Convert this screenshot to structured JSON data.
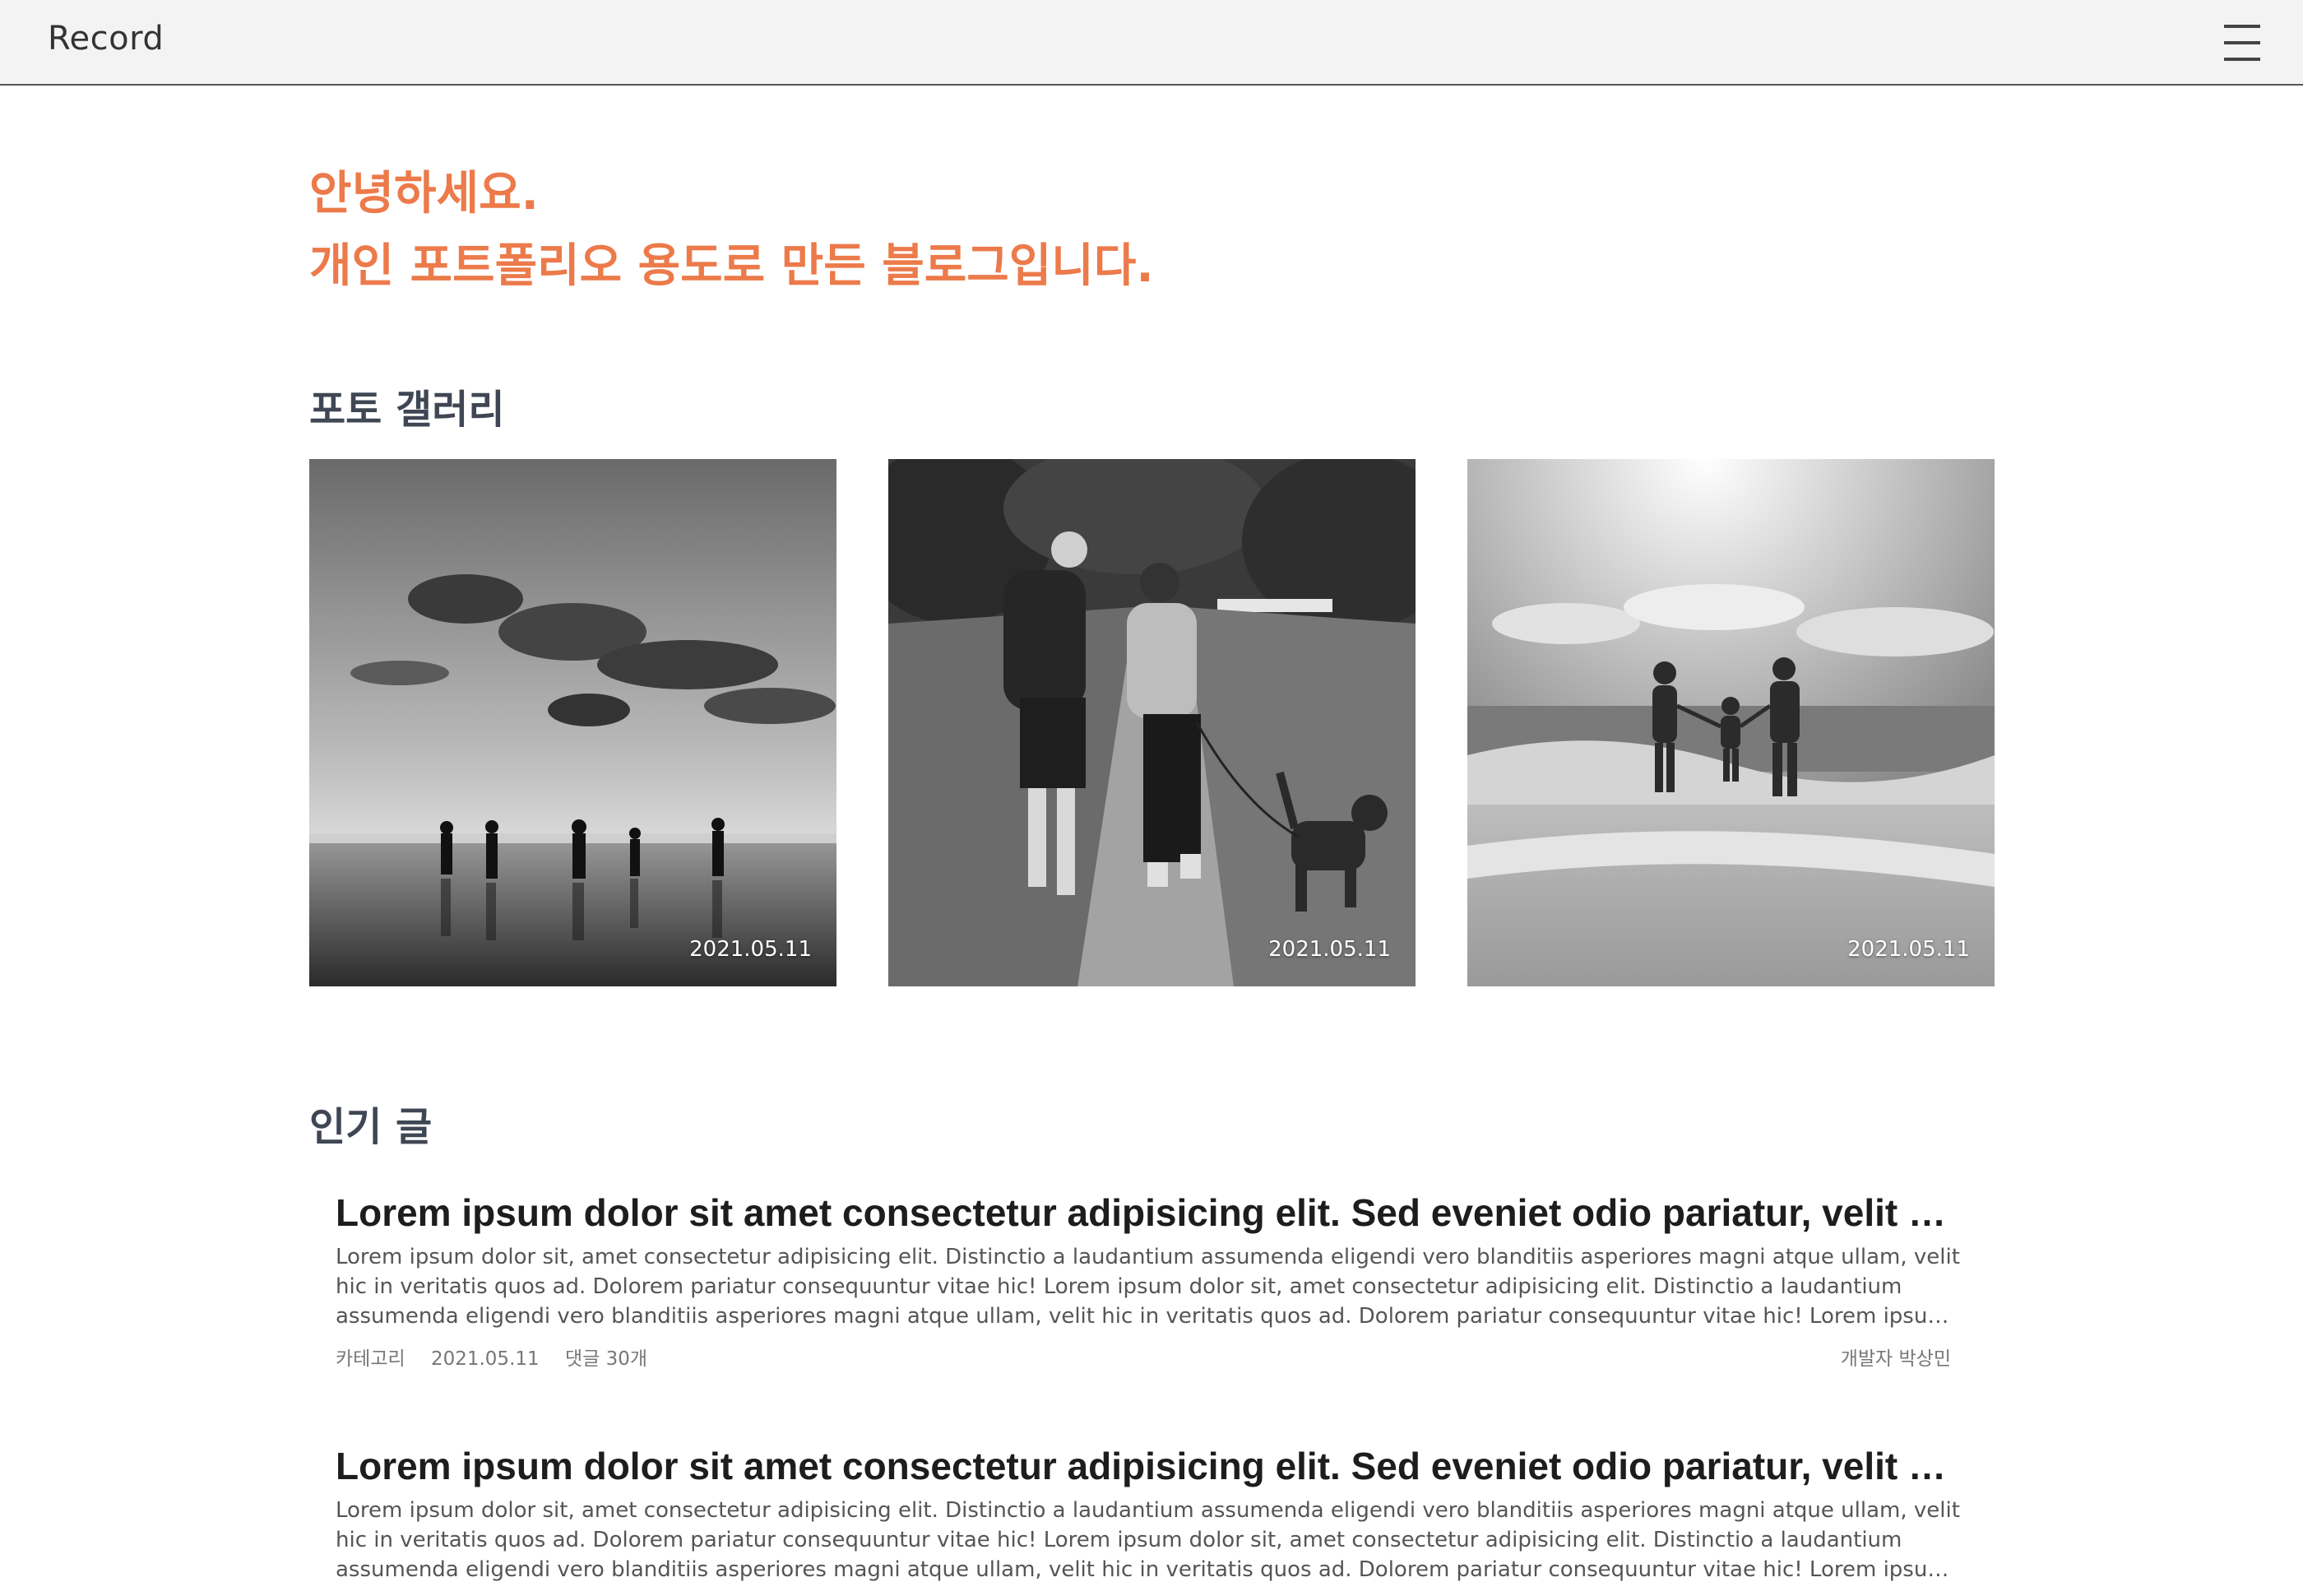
{
  "header": {
    "logo": "Record"
  },
  "hero": {
    "line1": "안녕하세요.",
    "line2": "개인 포트폴리오 용도로 만든 블로그입니다."
  },
  "gallery": {
    "title": "포토 갤러리",
    "items": [
      {
        "date": "2021.05.11"
      },
      {
        "date": "2021.05.11"
      },
      {
        "date": "2021.05.11"
      }
    ]
  },
  "popular": {
    "title": "인기 글",
    "posts": [
      {
        "title": "Lorem ipsum dolor sit amet consectetur adipisicing elit. Sed eveniet odio pariatur, velit cupi…",
        "body": "Lorem ipsum dolor sit, amet consectetur adipisicing elit. Distinctio a laudantium assumenda eligendi vero blanditiis asperiores magni atque ullam, velit hic in veritatis quos ad. Dolorem pariatur consequuntur vitae hic! Lorem ipsum dolor sit, amet consectetur adipisicing elit. Distinctio a laudantium assumenda eligendi vero blanditiis asperiores magni atque ullam, velit hic in veritatis quos ad. Dolorem pariatur consequuntur vitae hic! Lorem ipsum dolor sit, amet…",
        "category": "카테고리",
        "date": "2021.05.11",
        "comments": "댓글 30개",
        "author": "개발자 박상민"
      },
      {
        "title": "Lorem ipsum dolor sit amet consectetur adipisicing elit. Sed eveniet odio pariatur, velit cupi…",
        "body": "Lorem ipsum dolor sit, amet consectetur adipisicing elit. Distinctio a laudantium assumenda eligendi vero blanditiis asperiores magni atque ullam, velit hic in veritatis quos ad. Dolorem pariatur consequuntur vitae hic! Lorem ipsum dolor sit, amet consectetur adipisicing elit. Distinctio a laudantium assumenda eligendi vero blanditiis asperiores magni atque ullam, velit hic in veritatis quos ad. Dolorem pariatur consequuntur vitae hic! Lorem ipsum dolor sit, amet…"
      }
    ]
  },
  "colors": {
    "accent": "#ec7a4a",
    "heading": "#3f4654",
    "topbar_bg": "#f3f3f3"
  },
  "icons": {
    "menu": "hamburger-menu-icon"
  }
}
